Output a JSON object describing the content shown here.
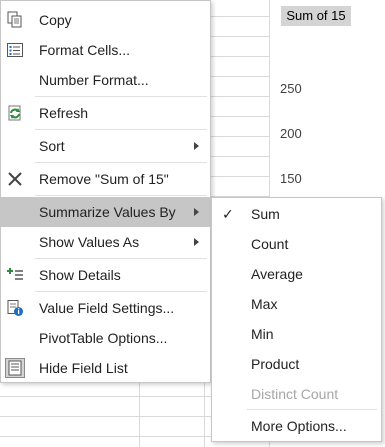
{
  "pivot_chart": {
    "field_button": "Sum of 15",
    "axis_ticks": [
      "250",
      "200",
      "150"
    ]
  },
  "context_menu": {
    "items": [
      {
        "label": "Copy",
        "icon": "copy-icon",
        "submenu": false
      },
      {
        "label": "Format Cells...",
        "icon": "format-cells-icon",
        "submenu": false
      },
      {
        "label": "Number Format...",
        "icon": "",
        "submenu": false
      },
      {
        "label": "Refresh",
        "icon": "refresh-icon",
        "submenu": false
      },
      {
        "label": "Sort",
        "icon": "",
        "submenu": true
      },
      {
        "label": "Remove \"Sum of 15\"",
        "icon": "remove-icon",
        "submenu": false
      },
      {
        "label": "Summarize Values By",
        "icon": "",
        "submenu": true,
        "active": true
      },
      {
        "label": "Show Values As",
        "icon": "",
        "submenu": true
      },
      {
        "label": "Show Details",
        "icon": "show-details-icon",
        "submenu": false
      },
      {
        "label": "Value Field Settings...",
        "icon": "value-field-settings-icon",
        "submenu": false
      },
      {
        "label": "PivotTable Options...",
        "icon": "",
        "submenu": false
      },
      {
        "label": "Hide Field List",
        "icon": "field-list-icon",
        "submenu": false
      }
    ]
  },
  "summarize_submenu": {
    "items": [
      {
        "label": "Sum",
        "checked": true,
        "disabled": false
      },
      {
        "label": "Count",
        "checked": false,
        "disabled": false
      },
      {
        "label": "Average",
        "checked": false,
        "disabled": false
      },
      {
        "label": "Max",
        "checked": false,
        "disabled": false
      },
      {
        "label": "Min",
        "checked": false,
        "disabled": false
      },
      {
        "label": "Product",
        "checked": false,
        "disabled": false
      },
      {
        "label": "Distinct Count",
        "checked": false,
        "disabled": true
      },
      {
        "label": "More Options...",
        "checked": false,
        "disabled": false
      }
    ]
  },
  "colors": {
    "active_highlight": "#c6c6c6",
    "disabled_text": "#a6a6a6",
    "refresh_icon": "#2e8b3e",
    "info_icon": "#1e6fc4",
    "badge_bg": "#d4d4d4"
  }
}
